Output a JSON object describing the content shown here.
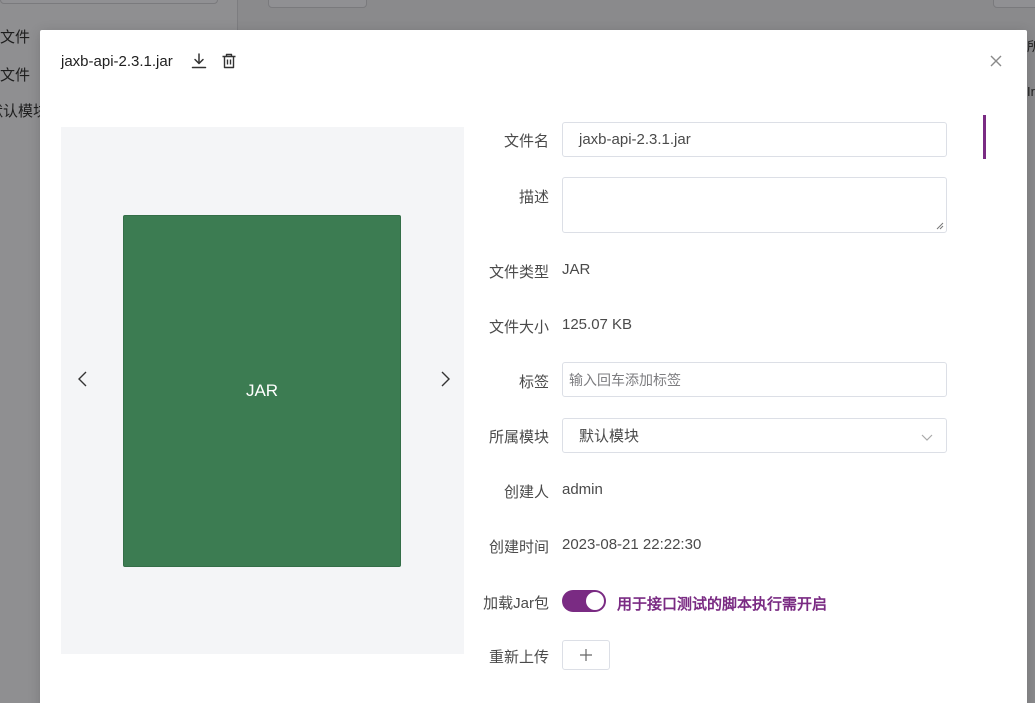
{
  "background": {
    "sidebar_items": [
      "文件",
      "文件",
      "默认模块"
    ],
    "right_column_fragments": [
      "所",
      "Ir",
      "",
      "",
      "",
      "",
      "",
      "",
      "",
      "",
      "",
      "",
      "",
      "",
      ""
    ]
  },
  "dialog": {
    "title": "jaxb-api-2.3.1.jar",
    "download_icon": "download-icon",
    "delete_icon": "trash-icon",
    "close_icon": "close-icon",
    "preview": {
      "file_type_text": "JAR",
      "prev_icon": "chevron-left-icon",
      "next_icon": "chevron-right-icon",
      "card_color": "#3c7c52"
    },
    "form": {
      "name_label": "文件名",
      "name_value": "jaxb-api-2.3.1.jar",
      "desc_label": "描述",
      "desc_value": "",
      "type_label": "文件类型",
      "type_value": "JAR",
      "size_label": "文件大小",
      "size_value": "125.07 KB",
      "tags_label": "标签",
      "tags_placeholder": "输入回车添加标签",
      "module_label": "所属模块",
      "module_value": "默认模块",
      "creator_label": "创建人",
      "creator_value": "admin",
      "created_label": "创建时间",
      "created_value": "2023-08-21 22:22:30",
      "load_jar_label": "加载Jar包",
      "load_jar_enabled": true,
      "load_jar_hint": "用于接口测试的脚本执行需开启",
      "reupload_label": "重新上传"
    },
    "accent_color": "#7a2b83"
  }
}
